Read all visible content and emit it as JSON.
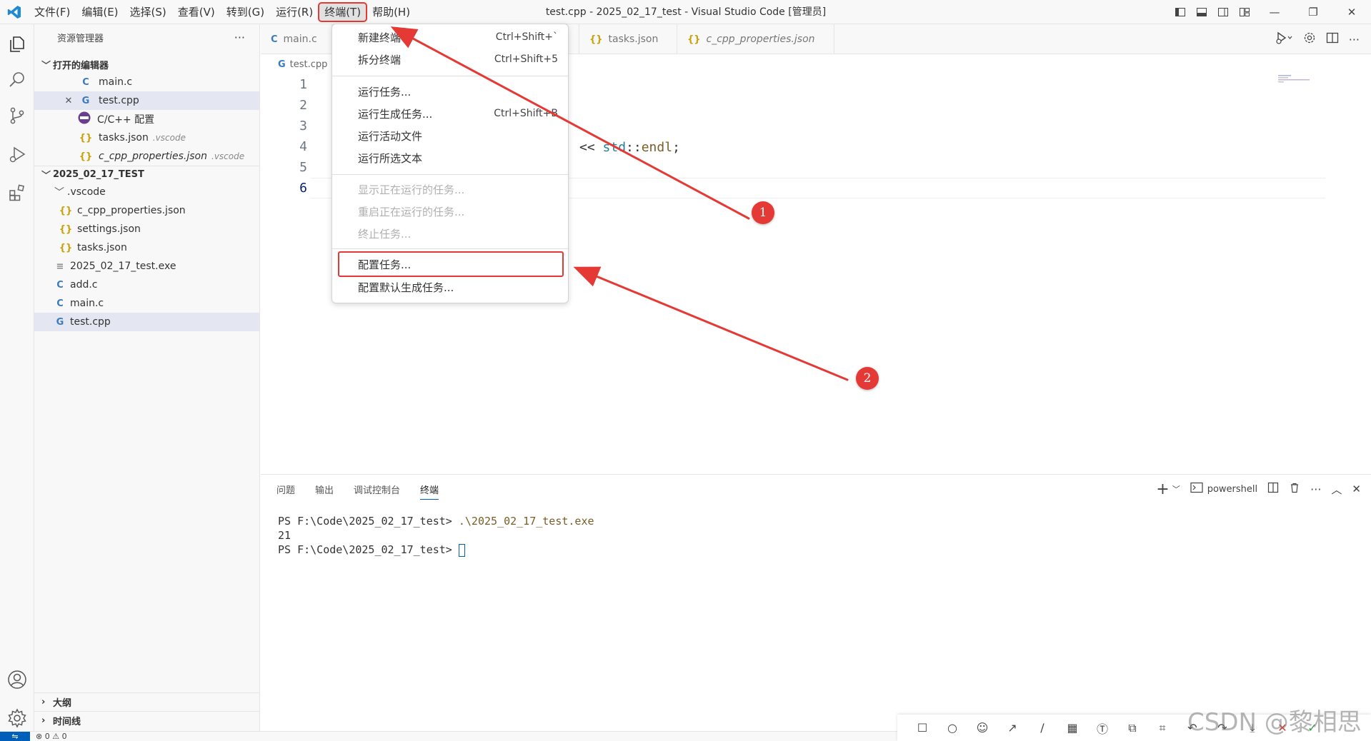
{
  "window": {
    "title": "test.cpp - 2025_02_17_test - Visual Studio Code [管理员]"
  },
  "menubar": {
    "items": [
      "文件(F)",
      "编辑(E)",
      "选择(S)",
      "查看(V)",
      "转到(G)",
      "运行(R)",
      "终端(T)",
      "帮助(H)"
    ]
  },
  "sidebar": {
    "title": "资源管理器",
    "more": "···",
    "open_editors_label": "打开的编辑器",
    "open_editors": [
      {
        "icon": "C",
        "name": "main.c",
        "suffix": ""
      },
      {
        "icon": "C+",
        "name": "test.cpp",
        "suffix": ""
      },
      {
        "icon": "gear",
        "name": "C/C++ 配置",
        "suffix": ""
      },
      {
        "icon": "{}",
        "name": "tasks.json",
        "suffix": ".vscode"
      },
      {
        "icon": "{}",
        "name": "c_cpp_properties.json",
        "suffix": ".vscode"
      }
    ],
    "folder_label": "2025_02_17_TEST",
    "tree": [
      {
        "icon": "chev",
        "name": ".vscode"
      },
      {
        "icon": "{}",
        "name": "c_cpp_properties.json"
      },
      {
        "icon": "{}",
        "name": "settings.json"
      },
      {
        "icon": "{}",
        "name": "tasks.json"
      },
      {
        "icon": "≡",
        "name": "2025_02_17_test.exe"
      },
      {
        "icon": "C",
        "name": "add.c"
      },
      {
        "icon": "C",
        "name": "main.c"
      },
      {
        "icon": "C+",
        "name": "test.cpp"
      }
    ],
    "outline_label": "大纲",
    "timeline_label": "时间线"
  },
  "tabs": [
    {
      "icon": "C",
      "label": "main.c",
      "italic": false
    },
    {
      "icon": "{}",
      "label": "tasks.json",
      "italic": false
    },
    {
      "icon": "{}",
      "label": "c_cpp_properties.json",
      "italic": true
    }
  ],
  "breadcrumb": {
    "file": "test.cpp"
  },
  "editor": {
    "line_numbers": [
      "1",
      "2",
      "3",
      "4",
      "5",
      "6"
    ],
    "visible_code": {
      "line4_op": "<< ",
      "line4_ns": "std",
      "line4_sep": "::",
      "line4_fn": "endl",
      "line4_end": ";"
    }
  },
  "dropdown": {
    "items": [
      {
        "label": "新建终端",
        "key": "Ctrl+Shift+`",
        "disabled": false
      },
      {
        "label": "拆分终端",
        "key": "Ctrl+Shift+5",
        "disabled": false
      },
      {
        "label": "运行任务...",
        "key": "",
        "disabled": false
      },
      {
        "label": "运行生成任务...",
        "key": "Ctrl+Shift+B",
        "disabled": false
      },
      {
        "label": "运行活动文件",
        "key": "",
        "disabled": false
      },
      {
        "label": "运行所选文本",
        "key": "",
        "disabled": false
      },
      {
        "label": "显示正在运行的任务...",
        "key": "",
        "disabled": true
      },
      {
        "label": "重启正在运行的任务...",
        "key": "",
        "disabled": true
      },
      {
        "label": "终止任务...",
        "key": "",
        "disabled": true
      },
      {
        "label": "配置任务...",
        "key": "",
        "disabled": false
      },
      {
        "label": "配置默认生成任务...",
        "key": "",
        "disabled": false
      }
    ]
  },
  "panel": {
    "tabs": [
      "问题",
      "输出",
      "调试控制台",
      "终端"
    ],
    "active_tab": "终端",
    "shell": "powershell",
    "terminal": {
      "prompt1": "PS F:\\Code\\2025_02_17_test> ",
      "cmd1": ".\\2025_02_17_test.exe",
      "output": "21",
      "prompt2": "PS F:\\Code\\2025_02_17_test> "
    }
  },
  "statusbar": {
    "problems": "⊗ 0 ⚠ 0"
  },
  "annotations": {
    "badge1": "1",
    "badge2": "2"
  },
  "watermark": "CSDN @黎相思",
  "colors": {
    "accent": "#005fb8",
    "annotation_red": "#e53935"
  }
}
